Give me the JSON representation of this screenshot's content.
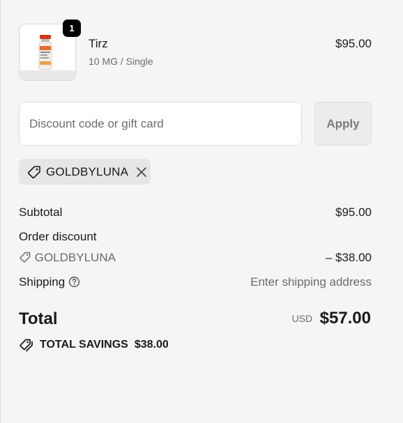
{
  "cart": {
    "item": {
      "quantity": "1",
      "name": "Tirz",
      "variant": "10 MG / Single",
      "price": "$95.00"
    }
  },
  "discount": {
    "placeholder": "Discount code or gift card",
    "value": "",
    "apply_label": "Apply",
    "applied_code": "GOLDBYLUNA"
  },
  "summary": {
    "subtotal_label": "Subtotal",
    "subtotal_value": "$95.00",
    "order_discount_label": "Order discount",
    "discount_code": "GOLDBYLUNA",
    "discount_value": "– $38.00",
    "shipping_label": "Shipping",
    "shipping_value": "Enter shipping address",
    "total_label": "Total",
    "currency": "USD",
    "total_value": "$57.00",
    "savings_label": "TOTAL SAVINGS",
    "savings_value": "$38.00"
  },
  "icons": {
    "tag": "tag-icon",
    "remove": "close-icon",
    "help": "question-circle-icon",
    "savings": "tags-icon"
  },
  "colors": {
    "background": "#f5f5f5",
    "badge": "#000000",
    "muted_text": "#6b6b6b",
    "tag_bg": "#e6e6e6"
  }
}
